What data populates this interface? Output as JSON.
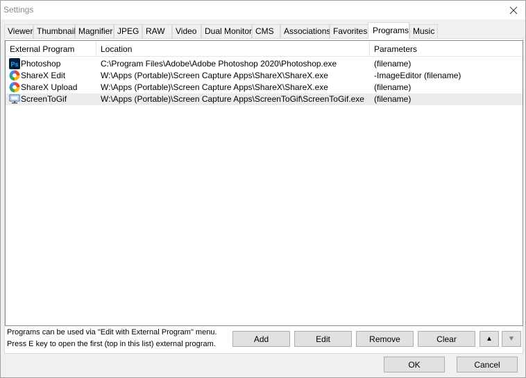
{
  "window": {
    "title": "Settings"
  },
  "tabs": [
    {
      "label": "Viewer",
      "active": false
    },
    {
      "label": "Thumbnail",
      "active": false
    },
    {
      "label": "Magnifier",
      "active": false
    },
    {
      "label": "JPEG",
      "active": false
    },
    {
      "label": "RAW",
      "active": false
    },
    {
      "label": "Video",
      "active": false
    },
    {
      "label": "Dual Monitor",
      "active": false
    },
    {
      "label": "CMS",
      "active": false
    },
    {
      "label": "Associations",
      "active": false
    },
    {
      "label": "Favorites",
      "active": false
    },
    {
      "label": "Programs",
      "active": true
    },
    {
      "label": "Music",
      "active": false
    }
  ],
  "list": {
    "columns": [
      "External Program",
      "Location",
      "Parameters"
    ],
    "rows": [
      {
        "icon": "photoshop-icon",
        "name": "Photoshop",
        "location": "C:\\Program Files\\Adobe\\Adobe Photoshop 2020\\Photoshop.exe",
        "parameters": "(filename)",
        "selected": false
      },
      {
        "icon": "sharex-icon",
        "name": "ShareX Edit",
        "location": "W:\\Apps (Portable)\\Screen Capture Apps\\ShareX\\ShareX.exe",
        "parameters": "-ImageEditor (filename)",
        "selected": false
      },
      {
        "icon": "sharex-icon",
        "name": "ShareX Upload",
        "location": "W:\\Apps (Portable)\\Screen Capture Apps\\ShareX\\ShareX.exe",
        "parameters": "(filename)",
        "selected": false
      },
      {
        "icon": "screentogif-icon",
        "name": "ScreenToGif",
        "location": "W:\\Apps (Portable)\\Screen Capture Apps\\ScreenToGif\\ScreenToGif.exe",
        "parameters": "(filename)",
        "selected": true
      }
    ]
  },
  "hints": {
    "line1": "Programs can be used via \"Edit with External Program\"  menu.",
    "line2": "Press E key to open the first (top in this list) external program."
  },
  "buttons": {
    "add": "Add",
    "edit": "Edit",
    "remove": "Remove",
    "clear": "Clear",
    "move_up": "▲",
    "move_down": "▼",
    "ok": "OK",
    "cancel": "Cancel"
  },
  "colors": {
    "photoshop_bg": "#001e36",
    "photoshop_fg": "#31a8ff",
    "selected_row": "#ececec"
  }
}
